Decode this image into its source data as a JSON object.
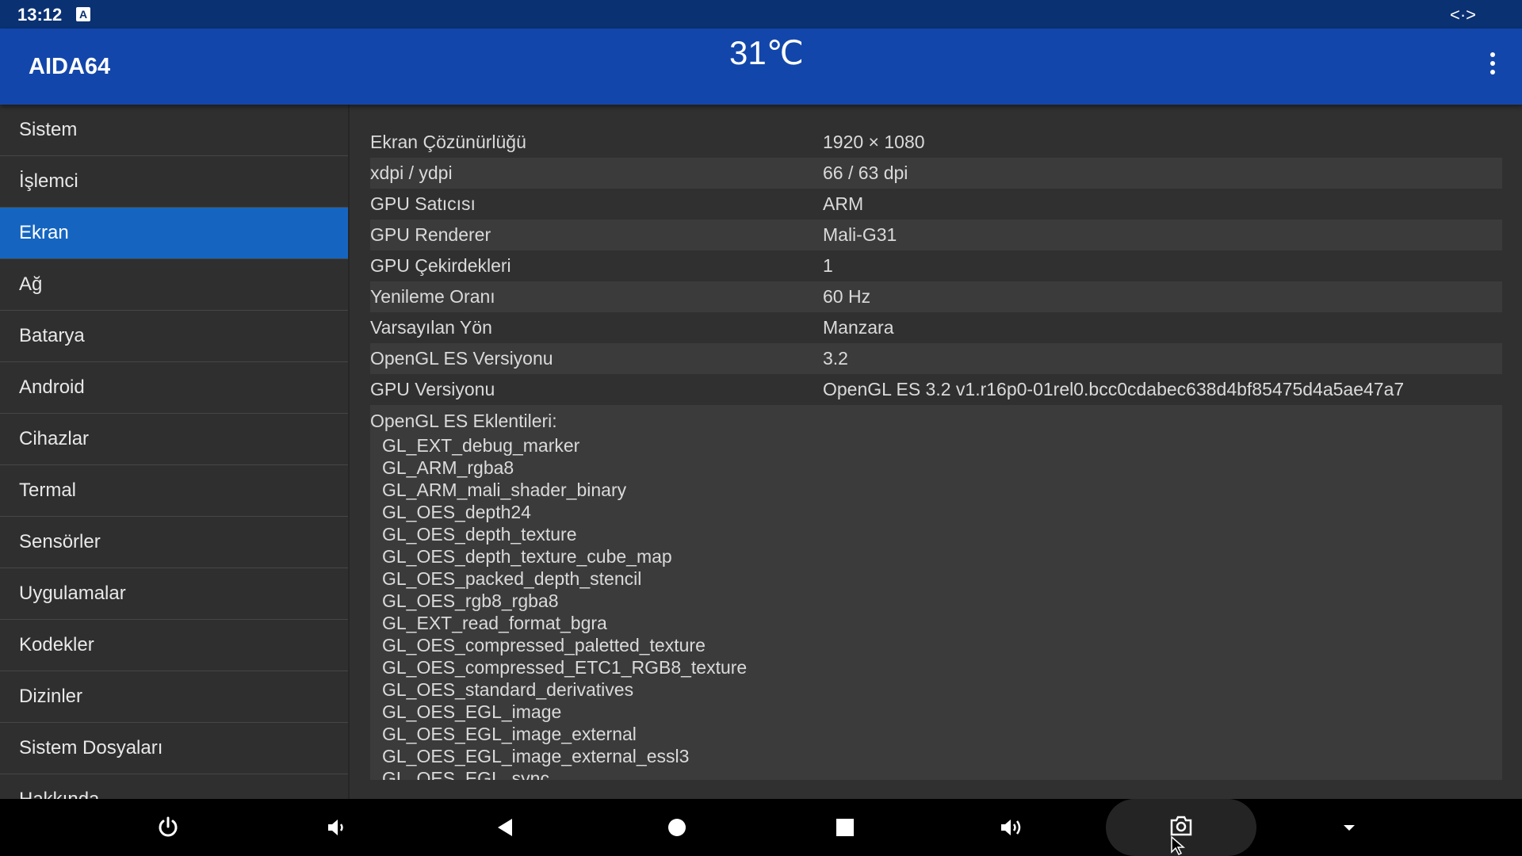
{
  "status_bar": {
    "time": "13:12",
    "notification_icon": "A",
    "cast_icon": "<·>"
  },
  "app_bar": {
    "title": "AIDA64",
    "temperature": "31℃"
  },
  "sidebar": {
    "items": [
      {
        "label": "Sistem"
      },
      {
        "label": "İşlemci"
      },
      {
        "label": "Ekran",
        "active": true
      },
      {
        "label": "Ağ"
      },
      {
        "label": "Batarya"
      },
      {
        "label": "Android"
      },
      {
        "label": "Cihazlar"
      },
      {
        "label": "Termal"
      },
      {
        "label": "Sensörler"
      },
      {
        "label": "Uygulamalar"
      },
      {
        "label": "Kodekler"
      },
      {
        "label": "Dizinler"
      },
      {
        "label": "Sistem Dosyaları"
      },
      {
        "label": "Hakkında"
      }
    ]
  },
  "details": {
    "rows": [
      {
        "key": "Ekran Çözünürlüğü",
        "value": "1920 × 1080"
      },
      {
        "key": "xdpi / ydpi",
        "value": "66 / 63 dpi"
      },
      {
        "key": "GPU Satıcısı",
        "value": "ARM"
      },
      {
        "key": "GPU Renderer",
        "value": "Mali-G31"
      },
      {
        "key": "GPU Çekirdekleri",
        "value": "1"
      },
      {
        "key": "Yenileme Oranı",
        "value": "60 Hz"
      },
      {
        "key": "Varsayılan Yön",
        "value": "Manzara"
      },
      {
        "key": "OpenGL ES Versiyonu",
        "value": "3.2"
      },
      {
        "key": "GPU Versiyonu",
        "value": "OpenGL ES 3.2 v1.r16p0-01rel0.bcc0cdabec638d4bf85475d4a5ae47a7"
      }
    ],
    "extensions_header": "OpenGL ES Eklentileri:",
    "extensions": [
      "GL_EXT_debug_marker",
      "GL_ARM_rgba8",
      "GL_ARM_mali_shader_binary",
      "GL_OES_depth24",
      "GL_OES_depth_texture",
      "GL_OES_depth_texture_cube_map",
      "GL_OES_packed_depth_stencil",
      "GL_OES_rgb8_rgba8",
      "GL_EXT_read_format_bgra",
      "GL_OES_compressed_paletted_texture",
      "GL_OES_compressed_ETC1_RGB8_texture",
      "GL_OES_standard_derivatives",
      "GL_OES_EGL_image",
      "GL_OES_EGL_image_external",
      "GL_OES_EGL_image_external_essl3",
      "GL_OES_EGL_sync"
    ]
  },
  "nav_bar": {
    "buttons": [
      "power-icon",
      "volume-down-icon",
      "back-icon",
      "home-icon",
      "recents-icon",
      "volume-up-icon",
      "screenshot-icon",
      "expand-icon"
    ]
  }
}
